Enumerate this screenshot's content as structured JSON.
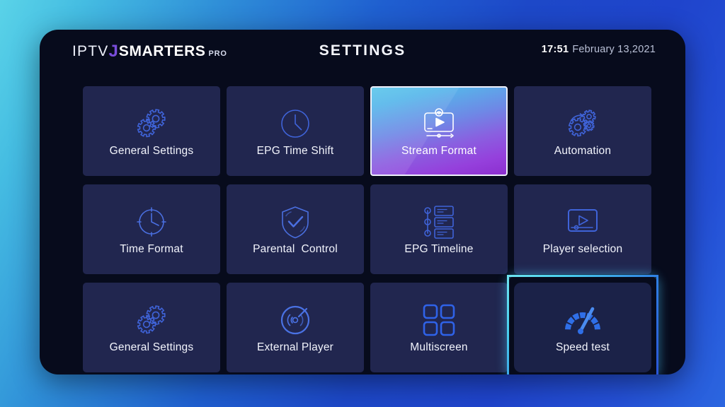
{
  "app": {
    "brand": {
      "part1": "IPTV",
      "separator": "J",
      "part2": "SMARTERS",
      "suffix": "PRO"
    },
    "title": "SETTINGS",
    "clock": {
      "time": "17:51",
      "date": "February 13,2021"
    },
    "colors": {
      "panel_background": "#070b1c",
      "tile_background": "#21264f",
      "icon_blue": "#3f63d8",
      "selected_gradient_start": "#5bc7ea",
      "selected_gradient_end": "#8c2fcf",
      "focus_ring": "#4ad0ee",
      "page_background_start": "#5ad3e8",
      "page_background_end": "#2b66e0",
      "label_text": "#f2f4fc"
    }
  },
  "grid": {
    "columns": 4,
    "rows": 3,
    "tiles": [
      {
        "label": "General Settings",
        "icon": "gears-icon",
        "state": "normal"
      },
      {
        "label": "EPG Time Shift",
        "icon": "clock-icon",
        "state": "normal"
      },
      {
        "label": "Stream Format",
        "icon": "stream-screen-icon",
        "state": "selected"
      },
      {
        "label": "Automation",
        "icon": "automation-gears-icon",
        "state": "normal"
      },
      {
        "label": "Time Format",
        "icon": "clock-ticks-icon",
        "state": "normal"
      },
      {
        "label": "Parental  Control",
        "icon": "shield-check-icon",
        "state": "normal"
      },
      {
        "label": "EPG Timeline",
        "icon": "timeline-icon",
        "state": "normal"
      },
      {
        "label": "Player selection",
        "icon": "video-player-icon",
        "state": "normal"
      },
      {
        "label": "General Settings",
        "icon": "gears-icon",
        "state": "normal"
      },
      {
        "label": "External Player",
        "icon": "disc-player-icon",
        "state": "normal"
      },
      {
        "label": "Multiscreen",
        "icon": "grid-four-icon",
        "state": "normal"
      },
      {
        "label": "Speed test",
        "icon": "speedometer-icon",
        "state": "focused"
      }
    ]
  }
}
